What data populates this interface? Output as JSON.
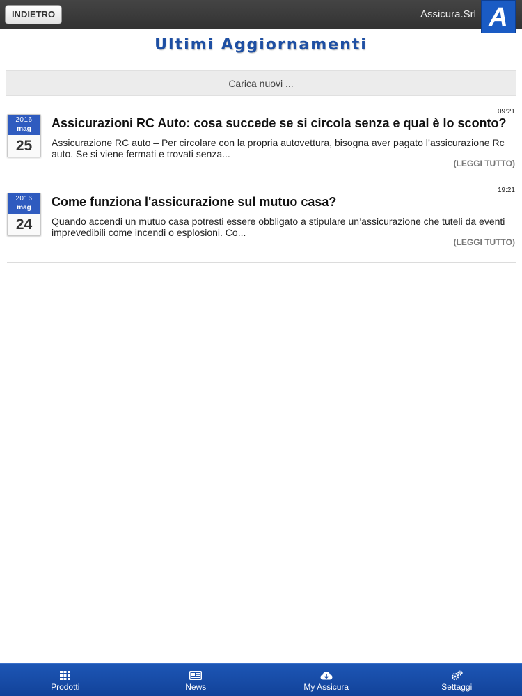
{
  "header": {
    "back_label": "INDIETRO",
    "brand_name": "Assicura.Srl",
    "logo_letter": "A"
  },
  "page_title": "Ultimi Aggiornamenti",
  "load_new_label": "Carica nuovi ...",
  "news": [
    {
      "year": "2016",
      "month": "mag",
      "day": "25",
      "time": "09:21",
      "title": "Assicurazioni RC Auto: cosa succede se si circola senza e qual è lo sconto?",
      "excerpt": "Assicurazione RC auto – Per circolare con la propria autovettura, bisogna aver pagato l’assicurazione Rc auto. Se si viene fermati e trovati senza...",
      "read_more": "(LEGGI TUTTO)"
    },
    {
      "year": "2016",
      "month": "mag",
      "day": "24",
      "time": "19:21",
      "title": "Come funziona l'assicurazione sul mutuo casa?",
      "excerpt": "Quando accendi un mutuo casa potresti essere obbligato a stipulare un’assicurazione che tuteli da eventi imprevedibili come incendi o esplosioni. Co...",
      "read_more": "(LEGGI TUTTO)"
    }
  ],
  "tabbar": {
    "items": [
      {
        "label": "Prodotti",
        "icon": "grid-icon"
      },
      {
        "label": "News",
        "icon": "newspaper-icon"
      },
      {
        "label": "My Assicura",
        "icon": "cloud-download-icon"
      },
      {
        "label": "Settaggi",
        "icon": "gears-icon"
      }
    ]
  },
  "colors": {
    "accent": "#1e4fa3",
    "tabbar": "#1a4fae",
    "date_badge": "#2f5bbf",
    "logo": "#1a5bc4"
  }
}
